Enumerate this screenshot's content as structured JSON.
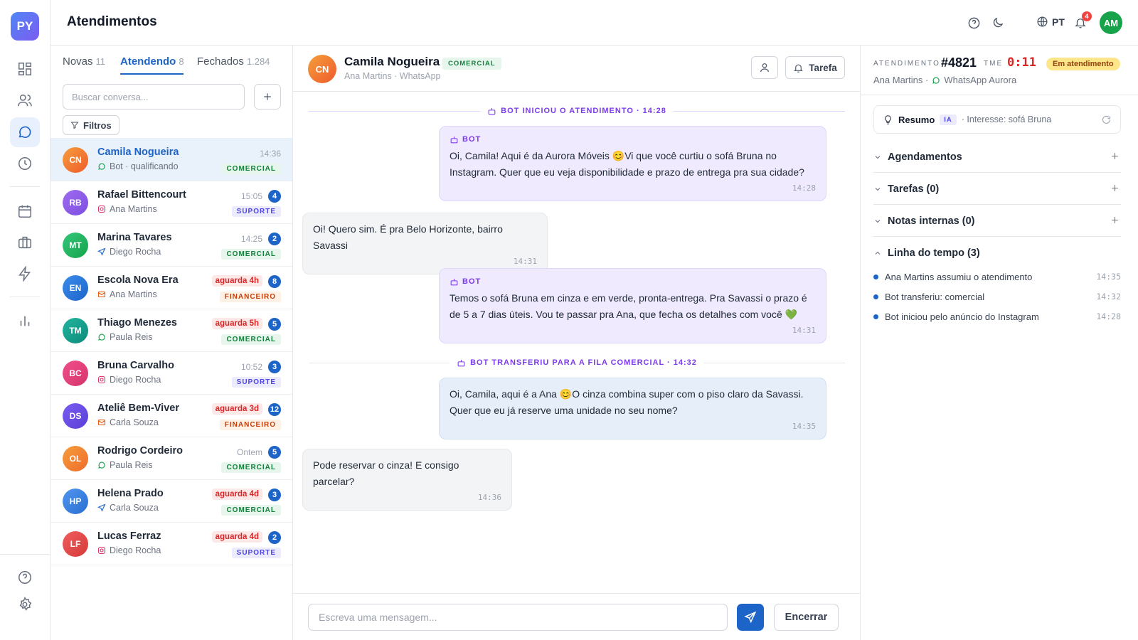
{
  "app": {
    "logo": "PY",
    "title": "Atendimentos"
  },
  "topbar": {
    "lang": "PT",
    "notif_count": "4",
    "avatar": "AM"
  },
  "rail": {
    "icons": [
      "dashboard-icon",
      "contacts-icon",
      "chat-icon",
      "history-icon",
      "calendar-icon",
      "briefcase-icon",
      "automation-icon",
      "reports-icon",
      "help-icon",
      "settings-icon"
    ]
  },
  "list": {
    "tabs": [
      {
        "label": "Novas",
        "count": "11"
      },
      {
        "label": "Atendendo",
        "count": "8"
      },
      {
        "label": "Fechados",
        "count": "1.284"
      }
    ],
    "search_placeholder": "Buscar conversa...",
    "filter_label": "Filtros",
    "conversations": [
      {
        "initials": "CN",
        "name": "Camila Nogueira",
        "sub": "Bot · qualificando",
        "channel": "whatsapp",
        "time": "14:36",
        "wait": "",
        "unread": "",
        "tag": "COMERCIAL",
        "tagclass": "t-com",
        "color": "linear-gradient(135deg,#f59e3c,#ef5b2b)",
        "selected": true
      },
      {
        "initials": "RB",
        "name": "Rafael Bittencourt",
        "sub": "Ana Martins",
        "channel": "instagram",
        "time": "15:05",
        "wait": "",
        "unread": "4",
        "tag": "SUPORTE",
        "tagclass": "t-sup",
        "color": "linear-gradient(135deg,#a06cf0,#7c4fe0)",
        "selected": false
      },
      {
        "initials": "MT",
        "name": "Marina Tavares",
        "sub": "Diego Rocha",
        "channel": "telegram",
        "time": "14:25",
        "wait": "",
        "unread": "2",
        "tag": "COMERCIAL",
        "tagclass": "t-com",
        "color": "linear-gradient(135deg,#34c77b,#16a34a)",
        "selected": false
      },
      {
        "initials": "EN",
        "name": "Escola Nova Era",
        "sub": "Ana Martins",
        "channel": "email",
        "time": "",
        "wait": "aguarda 4h",
        "unread": "8",
        "tag": "FINANCEIRO",
        "tagclass": "t-fin",
        "color": "linear-gradient(135deg,#3b8ded,#1d64c9)",
        "selected": false
      },
      {
        "initials": "TM",
        "name": "Thiago Menezes",
        "sub": "Paula Reis",
        "channel": "whatsapp",
        "time": "",
        "wait": "aguarda 5h",
        "unread": "5",
        "tag": "COMERCIAL",
        "tagclass": "t-com",
        "color": "linear-gradient(135deg,#22b5a0,#0f8a7a)",
        "selected": false
      },
      {
        "initials": "BC",
        "name": "Bruna Carvalho",
        "sub": "Diego Rocha",
        "channel": "instagram",
        "time": "10:52",
        "wait": "",
        "unread": "3",
        "tag": "SUPORTE",
        "tagclass": "t-sup",
        "color": "linear-gradient(135deg,#f0508a,#d6336c)",
        "selected": false
      },
      {
        "initials": "DS",
        "name": "Ateliê Bem-Viver",
        "sub": "Carla Souza",
        "channel": "email",
        "time": "",
        "wait": "aguarda 3d",
        "unread": "12",
        "tag": "FINANCEIRO",
        "tagclass": "t-fin",
        "color": "linear-gradient(135deg,#7a5cf0,#5b3fd6)",
        "selected": false
      },
      {
        "initials": "OL",
        "name": "Rodrigo Cordeiro",
        "sub": "Paula Reis",
        "channel": "whatsapp",
        "time": "Ontem",
        "wait": "",
        "unread": "5",
        "tag": "COMERCIAL",
        "tagclass": "t-com",
        "color": "linear-gradient(135deg,#f59e3c,#ef6b2b)",
        "selected": false
      },
      {
        "initials": "HP",
        "name": "Helena Prado",
        "sub": "Carla Souza",
        "channel": "telegram",
        "time": "",
        "wait": "aguarda 4d",
        "unread": "3",
        "tag": "COMERCIAL",
        "tagclass": "t-com",
        "color": "linear-gradient(135deg,#4f95ef,#2a6fd1)",
        "selected": false
      },
      {
        "initials": "LF",
        "name": "Lucas Ferraz",
        "sub": "Diego Rocha",
        "channel": "instagram",
        "time": "",
        "wait": "aguarda 4d",
        "unread": "2",
        "tag": "SUPORTE",
        "tagclass": "t-sup",
        "color": "linear-gradient(135deg,#f05d5d,#d63a3a)",
        "selected": false
      }
    ]
  },
  "chat": {
    "contact_initials": "CN",
    "contact_name": "Camila Nogueira",
    "contact_tag": "COMERCIAL",
    "contact_sub": "Ana Martins · WhatsApp",
    "task_button": "Tarefa",
    "sep1": "BOT INICIOU O ATENDIMENTO · 14:28",
    "sep2": "BOT TRANSFERIU PARA A FILA COMERCIAL · 14:32",
    "messages": [
      {
        "label": "BOT",
        "text": "Oi, Camila! Aqui é da Aurora Móveis 😊Vi que você curtiu o sofá Bruna no Instagram. Quer que eu veja disponibilidade e prazo de entrega pra sua cidade?",
        "time": "14:28"
      },
      {
        "label": "",
        "text": "Oi! Quero sim. É pra Belo Horizonte, bairro Savassi",
        "time": "14:31"
      },
      {
        "label": "BOT",
        "text": "Temos o sofá Bruna em cinza e em verde, pronta-entrega. Pra Savassi o prazo é de 5 a 7 dias úteis. Vou te passar pra Ana, que fecha os detalhes com você 💚",
        "time": "14:31"
      },
      {
        "label": "",
        "text": "Oi, Camila, aqui é a Ana 😊O cinza combina super com o piso claro da Savassi. Quer que eu já reserve uma unidade no seu nome?",
        "time": "14:35"
      },
      {
        "label": "",
        "text": "Pode reservar o cinza! E consigo parcelar?",
        "time": "14:36"
      }
    ],
    "input_placeholder": "Escreva uma mensagem...",
    "close_button": "Encerrar"
  },
  "details": {
    "label": "ATENDIMENTO",
    "id": "#4821",
    "tme_label": "TME",
    "timer": "0:11",
    "status": "Em atendimento",
    "agent": "Ana Martins ·",
    "channel": "WhatsApp Aurora",
    "summary_title": "Resumo",
    "summary_badge": "IA",
    "summary_text": "· Interesse: sofá Bruna",
    "sections": [
      "Agendamentos",
      "Tarefas (0)",
      "Notas internas (0)"
    ],
    "timeline_title": "Linha do tempo (3)",
    "timeline": [
      {
        "text": "Ana Martins assumiu o atendimento",
        "time": "14:35"
      },
      {
        "text": "Bot transferiu: comercial",
        "time": "14:32"
      },
      {
        "text": "Bot iniciou pelo anúncio do Instagram",
        "time": "14:28"
      }
    ]
  },
  "colors": {
    "accent": "#1d64c9",
    "bot": "#7c3aed",
    "danger": "#dc2626",
    "success": "#16a34a"
  }
}
